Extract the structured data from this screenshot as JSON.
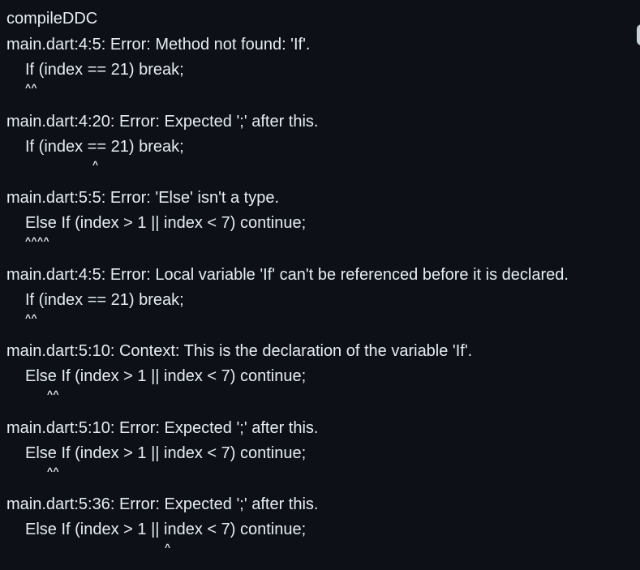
{
  "console": {
    "title": "compileDDC",
    "errors": [
      {
        "message": "main.dart:4:5: Error: Method not found: 'If'.",
        "source": "If (index == 21) break;",
        "caret": "^^"
      },
      {
        "message": "main.dart:4:20: Error: Expected ';' after this.",
        "source": "If (index == 21) break;",
        "caret": "^"
      },
      {
        "message": "main.dart:5:5: Error: 'Else' isn't a type.",
        "source": "Else If (index > 1 || index < 7) continue;",
        "caret": "^^^^"
      },
      {
        "message": "main.dart:4:5: Error: Local variable 'If' can't be referenced before it is declared.",
        "source": "If (index == 21) break;",
        "caret": "^^"
      },
      {
        "message": "main.dart:5:10: Context: This is the declaration of the variable 'If'.",
        "source": "Else If (index > 1 || index < 7) continue;",
        "caret": "^^"
      },
      {
        "message": "main.dart:5:10: Error: Expected ';' after this.",
        "source": "Else If (index > 1 || index < 7) continue;",
        "caret": "^^"
      },
      {
        "message": "main.dart:5:36: Error: Expected ';' after this.",
        "source": "Else If (index > 1 || index < 7) continue;",
        "caret": "^"
      }
    ]
  }
}
